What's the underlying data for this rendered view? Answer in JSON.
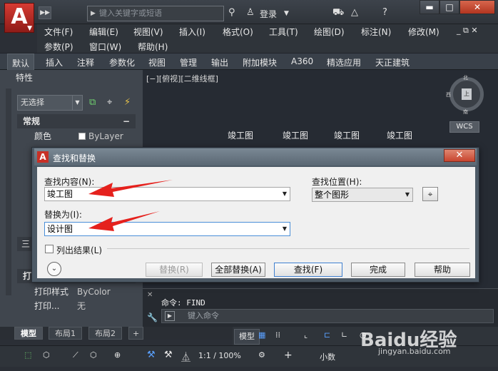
{
  "titlebar": {
    "logo_letter": "A",
    "search_placeholder": "键入关键字或短语",
    "login_label": "登录"
  },
  "menubar": {
    "items_row1": [
      "文件(F)",
      "编辑(E)",
      "视图(V)",
      "插入(I)",
      "格式(O)",
      "工具(T)",
      "绘图(D)",
      "标注(N)",
      "修改(M)"
    ],
    "items_row2": [
      "参数(P)",
      "窗口(W)",
      "帮助(H)"
    ]
  },
  "ribbon": {
    "tabs": [
      "默认",
      "插入",
      "注释",
      "参数化",
      "视图",
      "管理",
      "输出",
      "附加模块",
      "A360",
      "精选应用",
      "天正建筑"
    ]
  },
  "properties": {
    "title": "特性",
    "selection": "无选择",
    "section_general": "常规",
    "color_label": "颜色",
    "color_value": "ByLayer",
    "section_print": "打",
    "print_style_label": "打印样式",
    "print_style_value": "ByColor",
    "print_more_label": "打印...",
    "print_more_value": "无",
    "collapsed_marker": "三"
  },
  "canvas": {
    "view_label": "[−][俯视][二维线框]",
    "texts": [
      "竣工图",
      "竣工图",
      "竣工图",
      "竣工图"
    ],
    "viewcube": {
      "north": "北",
      "south": "南",
      "west": "西",
      "face": "上"
    },
    "wcs_label": "WCS"
  },
  "command": {
    "history": "命令: FIND",
    "placeholder": "键入命令"
  },
  "layout_tabs": [
    "模型",
    "布局1",
    "布局2"
  ],
  "status": {
    "model_label": "模型",
    "scale": "1:1 / 100%",
    "units": "小数"
  },
  "dialog": {
    "title": "查找和替换",
    "find_label": "查找内容(N):",
    "find_value": "竣工图",
    "replace_label": "替换为(I):",
    "replace_value": "设计图",
    "location_label": "查找位置(H):",
    "location_value": "整个图形",
    "list_results_label": "列出结果(L)",
    "buttons": {
      "replace": "替换(R)",
      "replace_all": "全部替换(A)",
      "find": "查找(F)",
      "done": "完成",
      "help": "帮助"
    }
  },
  "watermark": {
    "brand": "Baidu经验",
    "url": "jingyan.baidu.com"
  },
  "colors": {
    "arrow": "#e5211d",
    "logo": "#c8302a",
    "canvas_bg": "#262b33"
  }
}
